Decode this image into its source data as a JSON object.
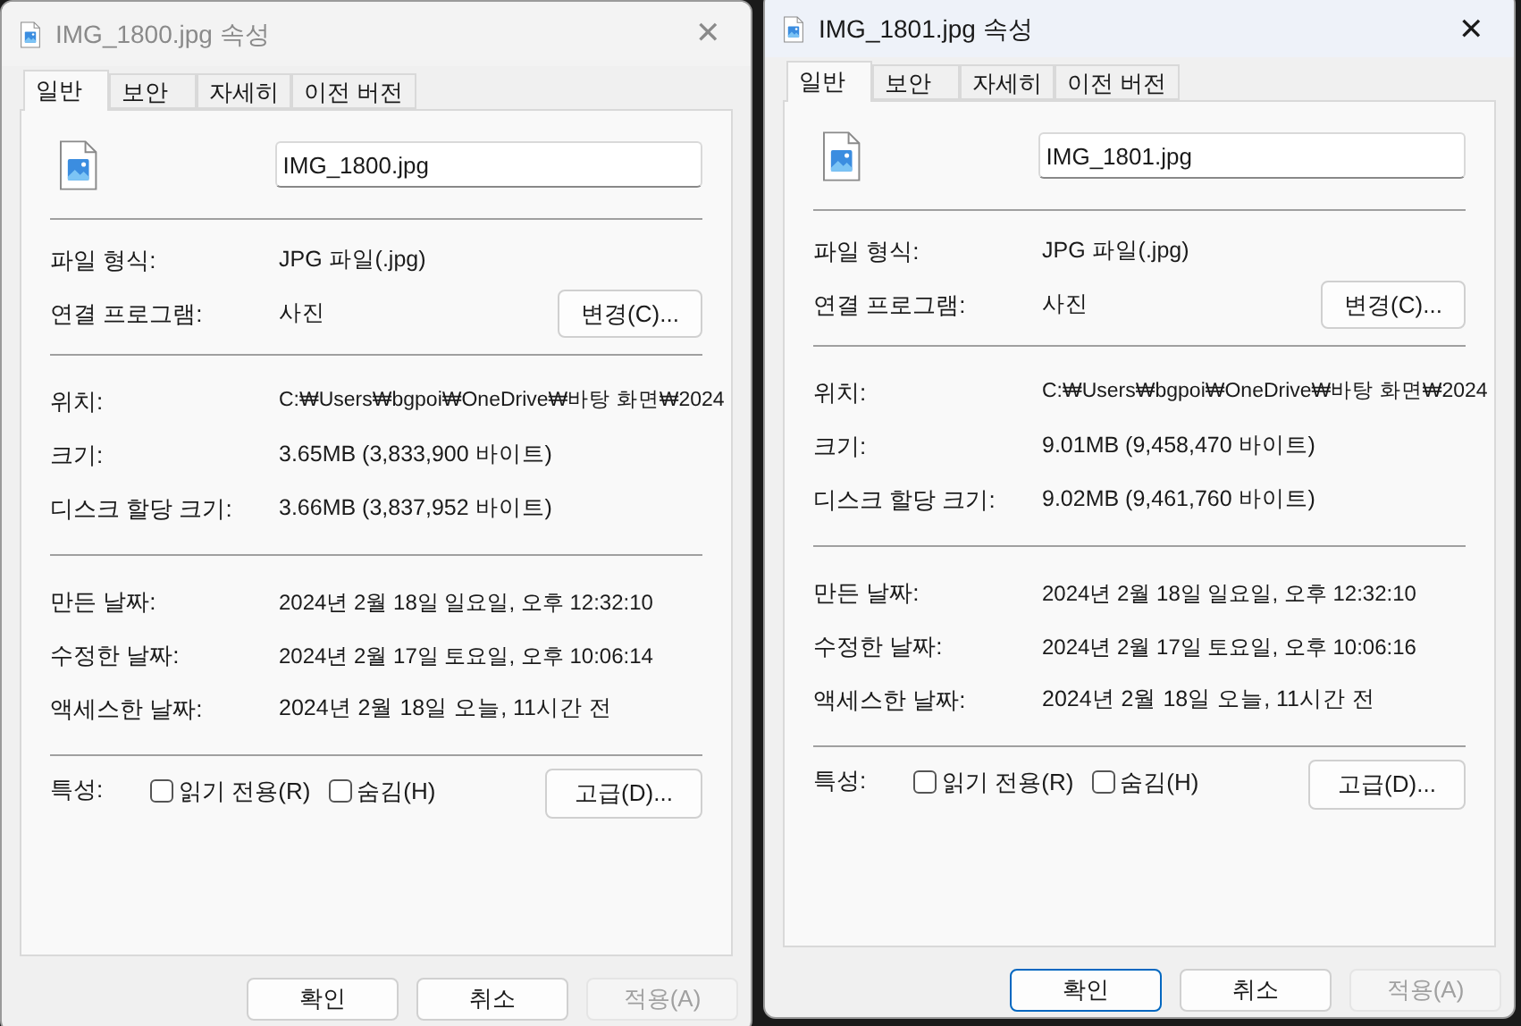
{
  "windows": [
    {
      "title": "IMG_1800.jpg 속성",
      "active": false,
      "close": "✕",
      "tabs": [
        {
          "label": "일반",
          "selected": true
        },
        {
          "label": "보안",
          "selected": false
        },
        {
          "label": "자세히",
          "selected": false
        },
        {
          "label": "이전 버전",
          "selected": false
        }
      ],
      "file_name": "IMG_1800.jpg",
      "sections": [
        [
          {
            "label": "파일 형식:",
            "value": "JPG 파일(.jpg)"
          },
          {
            "label": "연결 프로그램:",
            "value": "사진",
            "button": "변경(C)..."
          }
        ],
        [
          {
            "label": "위치:",
            "value": "C:₩Users₩bgpoi₩OneDrive₩바탕 화면₩2024"
          },
          {
            "label": "크기:",
            "value": "3.65MB (3,833,900 바이트)"
          },
          {
            "label": "디스크 할당 크기:",
            "value": "3.66MB (3,837,952 바이트)"
          }
        ],
        [
          {
            "label": "만든 날짜:",
            "value": "2024년 2월 18일 일요일, 오후 12:32:10"
          },
          {
            "label": "수정한 날짜:",
            "value": "2024년 2월 17일 토요일, 오후 10:06:14"
          },
          {
            "label": "액세스한 날짜:",
            "value": "2024년 2월 18일 오늘, 11시간 전"
          }
        ]
      ],
      "attributes": {
        "label": "특성:",
        "options": [
          {
            "label": "읽기 전용(R)",
            "checked": false
          },
          {
            "label": "숨김(H)",
            "checked": false
          }
        ],
        "button": "고급(D)..."
      },
      "buttons": [
        {
          "label": "확인",
          "focused": false,
          "disabled": false
        },
        {
          "label": "취소",
          "focused": false,
          "disabled": false
        },
        {
          "label": "적용(A)",
          "focused": false,
          "disabled": true
        }
      ]
    },
    {
      "title": "IMG_1801.jpg 속성",
      "active": true,
      "close": "✕",
      "tabs": [
        {
          "label": "일반",
          "selected": true
        },
        {
          "label": "보안",
          "selected": false
        },
        {
          "label": "자세히",
          "selected": false
        },
        {
          "label": "이전 버전",
          "selected": false
        }
      ],
      "file_name": "IMG_1801.jpg",
      "sections": [
        [
          {
            "label": "파일 형식:",
            "value": "JPG 파일(.jpg)"
          },
          {
            "label": "연결 프로그램:",
            "value": "사진",
            "button": "변경(C)..."
          }
        ],
        [
          {
            "label": "위치:",
            "value": "C:₩Users₩bgpoi₩OneDrive₩바탕 화면₩2024"
          },
          {
            "label": "크기:",
            "value": "9.01MB (9,458,470 바이트)"
          },
          {
            "label": "디스크 할당 크기:",
            "value": "9.02MB (9,461,760 바이트)"
          }
        ],
        [
          {
            "label": "만든 날짜:",
            "value": "2024년 2월 18일 일요일, 오후 12:32:10"
          },
          {
            "label": "수정한 날짜:",
            "value": "2024년 2월 17일 토요일, 오후 10:06:16"
          },
          {
            "label": "액세스한 날짜:",
            "value": "2024년 2월 18일 오늘, 11시간 전"
          }
        ]
      ],
      "attributes": {
        "label": "특성:",
        "options": [
          {
            "label": "읽기 전용(R)",
            "checked": false
          },
          {
            "label": "숨김(H)",
            "checked": false
          }
        ],
        "button": "고급(D)..."
      },
      "buttons": [
        {
          "label": "확인",
          "focused": true,
          "disabled": false
        },
        {
          "label": "취소",
          "focused": false,
          "disabled": false
        },
        {
          "label": "적용(A)",
          "focused": false,
          "disabled": true
        }
      ]
    }
  ]
}
